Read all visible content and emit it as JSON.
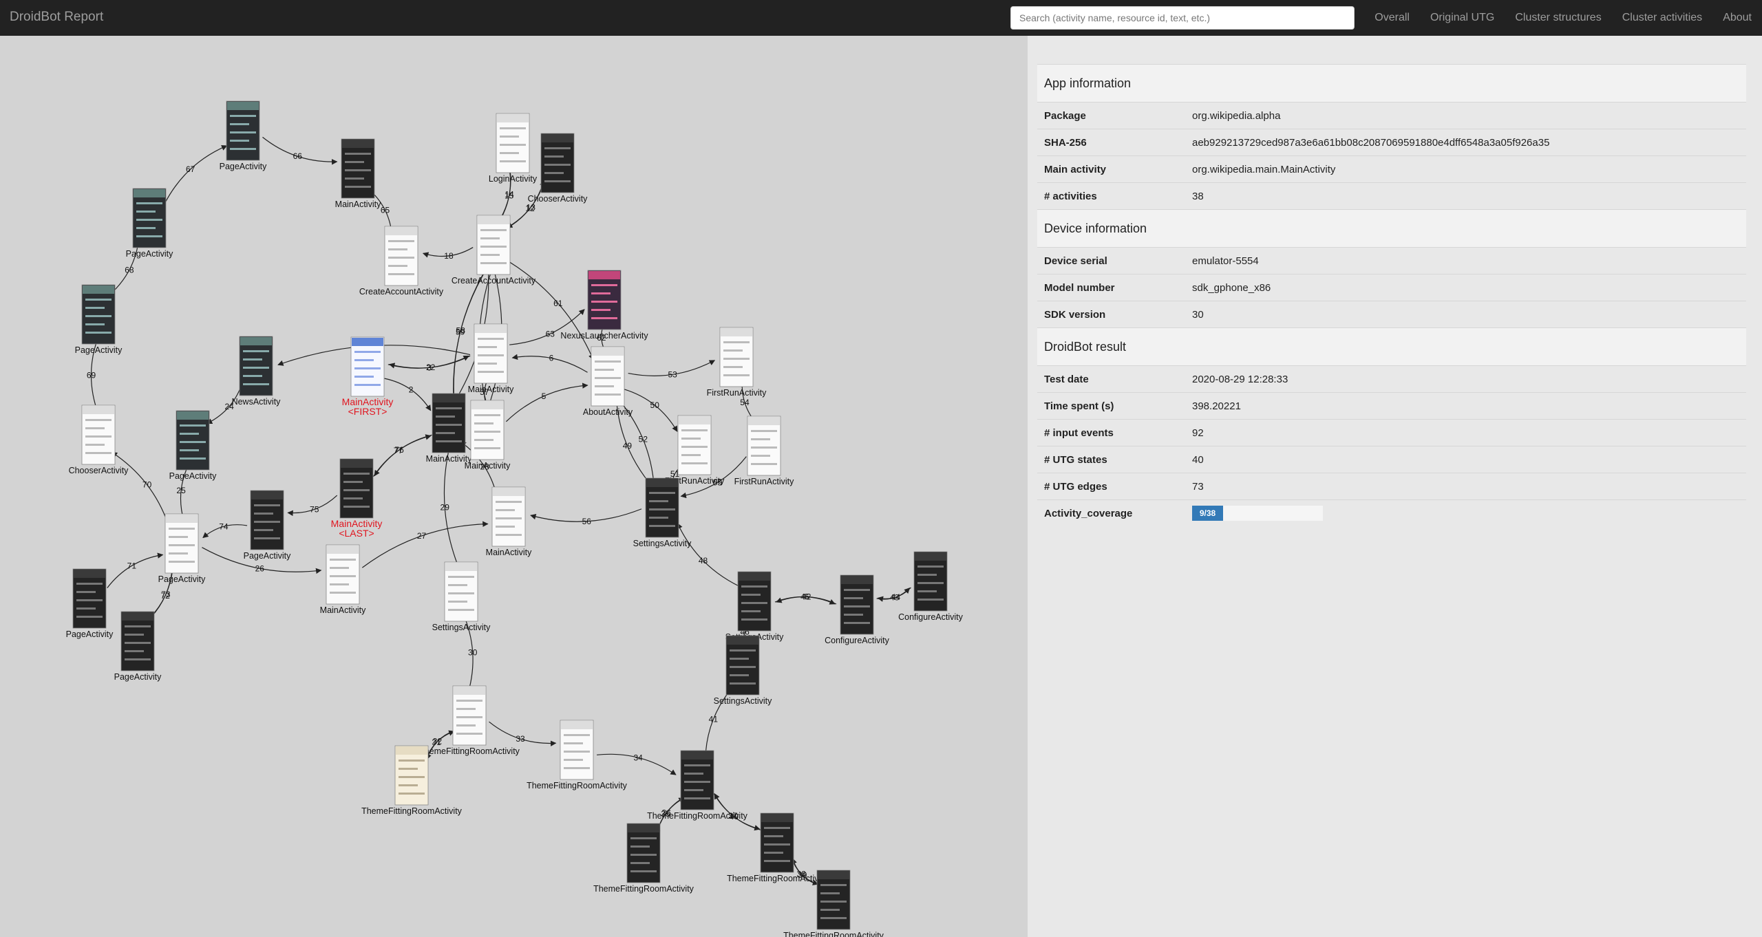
{
  "navbar": {
    "brand": "DroidBot Report",
    "search_placeholder": "Search (activity name, resource id, text, etc.)",
    "links": [
      "Overall",
      "Original UTG",
      "Cluster structures",
      "Cluster activities",
      "About"
    ]
  },
  "graph": {
    "nodes": [
      {
        "label": "PageActivity",
        "theme": "photo"
      },
      {
        "label": "MainActivity",
        "theme": "dark"
      },
      {
        "label": "LoginActivity",
        "theme": "light"
      },
      {
        "label": "ChooserActivity",
        "theme": "dark"
      },
      {
        "label": "PageActivity",
        "theme": "photo"
      },
      {
        "label": "CreateAccountActivity",
        "theme": "light"
      },
      {
        "label": "CreateAccountActivity",
        "theme": "light"
      },
      {
        "label": "NexusLauncherActivity",
        "theme": "pink"
      },
      {
        "label": "PageActivity",
        "theme": "photo"
      },
      {
        "label": "NewsActivity",
        "theme": "photo"
      },
      {
        "label": "MainActivity",
        "theme": "blue",
        "tag": "<FIRST>"
      },
      {
        "label": "MainActivity",
        "theme": "light"
      },
      {
        "label": "AboutActivity",
        "theme": "light"
      },
      {
        "label": "FirstRunActivity",
        "theme": "light"
      },
      {
        "label": "ChooserActivity",
        "theme": "light"
      },
      {
        "label": "MainActivity",
        "theme": "dark"
      },
      {
        "label": "MainActivity",
        "theme": "light"
      },
      {
        "label": "PageActivity",
        "theme": "photo"
      },
      {
        "label": "FirstRunActivity",
        "theme": "light"
      },
      {
        "label": "FirstRunActivity",
        "theme": "light"
      },
      {
        "label": "MainActivity",
        "theme": "dark",
        "tag": "<LAST>"
      },
      {
        "label": "PageActivity",
        "theme": "dark"
      },
      {
        "label": "MainActivity",
        "theme": "light"
      },
      {
        "label": "SettingsActivity",
        "theme": "dark"
      },
      {
        "label": "PageActivity",
        "theme": "light"
      },
      {
        "label": "MainActivity",
        "theme": "light"
      },
      {
        "label": "SettingsActivity",
        "theme": "light"
      },
      {
        "label": "PageActivity",
        "theme": "dark"
      },
      {
        "label": "PageActivity",
        "theme": "dark"
      },
      {
        "label": "ConfigureActivity",
        "theme": "dark"
      },
      {
        "label": "ConfigureActivity",
        "theme": "dark"
      },
      {
        "label": "SettingsActivity",
        "theme": "dark"
      },
      {
        "label": "SettingsActivity",
        "theme": "dark"
      },
      {
        "label": "ThemeFittingRoomActivity",
        "theme": "light"
      },
      {
        "label": "ThemeFittingRoomActivity",
        "theme": "light"
      },
      {
        "label": "ThemeFittingRoomActivity",
        "theme": "cream"
      },
      {
        "label": "ThemeFittingRoomActivity",
        "theme": "dark"
      },
      {
        "label": "ThemeFittingRoomActivity",
        "theme": "dark"
      },
      {
        "label": "ThemeFittingRoomActivity",
        "theme": "dark"
      },
      {
        "label": "ThemeFittingRoomActivity",
        "theme": "dark"
      }
    ],
    "edges": [
      {
        "from": 0,
        "to": 1,
        "label": "66"
      },
      {
        "from": 4,
        "to": 0,
        "label": "67"
      },
      {
        "from": 8,
        "to": 4,
        "label": "68"
      },
      {
        "from": 14,
        "to": 8,
        "label": "69"
      },
      {
        "from": 24,
        "to": 14,
        "label": "70"
      },
      {
        "from": 27,
        "to": 24,
        "label": "71"
      },
      {
        "from": 28,
        "to": 24,
        "label": "72"
      },
      {
        "from": 24,
        "to": 28,
        "label": "73"
      },
      {
        "from": 21,
        "to": 24,
        "label": "74"
      },
      {
        "from": 20,
        "to": 21,
        "label": "75"
      },
      {
        "from": 15,
        "to": 20,
        "label": "76"
      },
      {
        "from": 20,
        "to": 15,
        "label": "77"
      },
      {
        "from": 5,
        "to": 1,
        "label": "65"
      },
      {
        "from": 6,
        "to": 5,
        "label": "18"
      },
      {
        "from": 6,
        "to": 2,
        "label": "15"
      },
      {
        "from": 2,
        "to": 6,
        "label": "14"
      },
      {
        "from": 6,
        "to": 3,
        "label": "12"
      },
      {
        "from": 3,
        "to": 6,
        "label": "13"
      },
      {
        "from": 15,
        "to": 6,
        "label": "11"
      },
      {
        "from": 16,
        "to": 6,
        "label": "20"
      },
      {
        "from": 6,
        "to": 15,
        "label": "58"
      },
      {
        "from": 6,
        "to": 16,
        "label": "64"
      },
      {
        "from": 11,
        "to": 7,
        "label": "63"
      },
      {
        "from": 6,
        "to": 12,
        "label": "61"
      },
      {
        "from": 7,
        "to": 12,
        "label": "62"
      },
      {
        "from": 15,
        "to": 6,
        "label": "59"
      },
      {
        "from": 11,
        "to": 9,
        "label": "23"
      },
      {
        "from": 11,
        "to": 10,
        "label": "22"
      },
      {
        "from": 10,
        "to": 11,
        "label": "3"
      },
      {
        "from": 10,
        "to": 15,
        "label": "2"
      },
      {
        "from": 12,
        "to": 11,
        "label": "6"
      },
      {
        "from": 16,
        "to": 12,
        "label": "5"
      },
      {
        "from": 12,
        "to": 13,
        "label": "53"
      },
      {
        "from": 12,
        "to": 18,
        "label": "50"
      },
      {
        "from": 13,
        "to": 19,
        "label": "54"
      },
      {
        "from": 23,
        "to": 12,
        "label": "49"
      },
      {
        "from": 23,
        "to": 12,
        "label": "52"
      },
      {
        "from": 19,
        "to": 23,
        "label": "55"
      },
      {
        "from": 18,
        "to": 23,
        "label": "51"
      },
      {
        "from": 16,
        "to": 11,
        "label": "57"
      },
      {
        "from": 22,
        "to": 15,
        "label": "28"
      },
      {
        "from": 23,
        "to": 22,
        "label": "56"
      },
      {
        "from": 15,
        "to": 26,
        "label": "29"
      },
      {
        "from": 25,
        "to": 22,
        "label": "27"
      },
      {
        "from": 24,
        "to": 25,
        "label": "26"
      },
      {
        "from": 9,
        "to": 17,
        "label": "24"
      },
      {
        "from": 17,
        "to": 24,
        "label": "25"
      },
      {
        "from": 26,
        "to": 33,
        "label": "30"
      },
      {
        "from": 33,
        "to": 35,
        "label": "32"
      },
      {
        "from": 35,
        "to": 33,
        "label": "31"
      },
      {
        "from": 33,
        "to": 34,
        "label": "33"
      },
      {
        "from": 34,
        "to": 36,
        "label": "34"
      },
      {
        "from": 36,
        "to": 37,
        "label": "36"
      },
      {
        "from": 37,
        "to": 36,
        "label": "35"
      },
      {
        "from": 36,
        "to": 38,
        "label": "37"
      },
      {
        "from": 38,
        "to": 36,
        "label": "40"
      },
      {
        "from": 38,
        "to": 39,
        "label": "38"
      },
      {
        "from": 39,
        "to": 38,
        "label": "39"
      },
      {
        "from": 32,
        "to": 36,
        "label": "41"
      },
      {
        "from": 31,
        "to": 30,
        "label": "45"
      },
      {
        "from": 30,
        "to": 31,
        "label": "42"
      },
      {
        "from": 29,
        "to": 30,
        "label": "44"
      },
      {
        "from": 30,
        "to": 29,
        "label": "43"
      },
      {
        "from": 31,
        "to": 23,
        "label": "48"
      },
      {
        "from": 31,
        "to": 32,
        "label": "46"
      }
    ]
  },
  "info": {
    "app_section": "App information",
    "package_key": "Package",
    "package": "org.wikipedia.alpha",
    "sha_key": "SHA-256",
    "sha": "aeb929213729ced987a3e6a61bb08c2087069591880e4dff6548a3a05f926a35",
    "main_key": "Main activity",
    "main": "org.wikipedia.main.MainActivity",
    "activities_key": "# activities",
    "activities": "38",
    "device_section": "Device information",
    "serial_key": "Device serial",
    "serial": "emulator-5554",
    "model_key": "Model number",
    "model": "sdk_gphone_x86",
    "sdk_key": "SDK version",
    "sdk": "30",
    "result_section": "DroidBot result",
    "date_key": "Test date",
    "date": "2020-08-29 12:28:33",
    "time_key": "Time spent (s)",
    "time": "398.20221",
    "events_key": "# input events",
    "events": "92",
    "states_key": "# UTG states",
    "states": "40",
    "edges_key": "# UTG edges",
    "edges": "73",
    "coverage_key": "Activity_coverage",
    "coverage": "9/38",
    "coverage_fraction": 0.2368
  }
}
